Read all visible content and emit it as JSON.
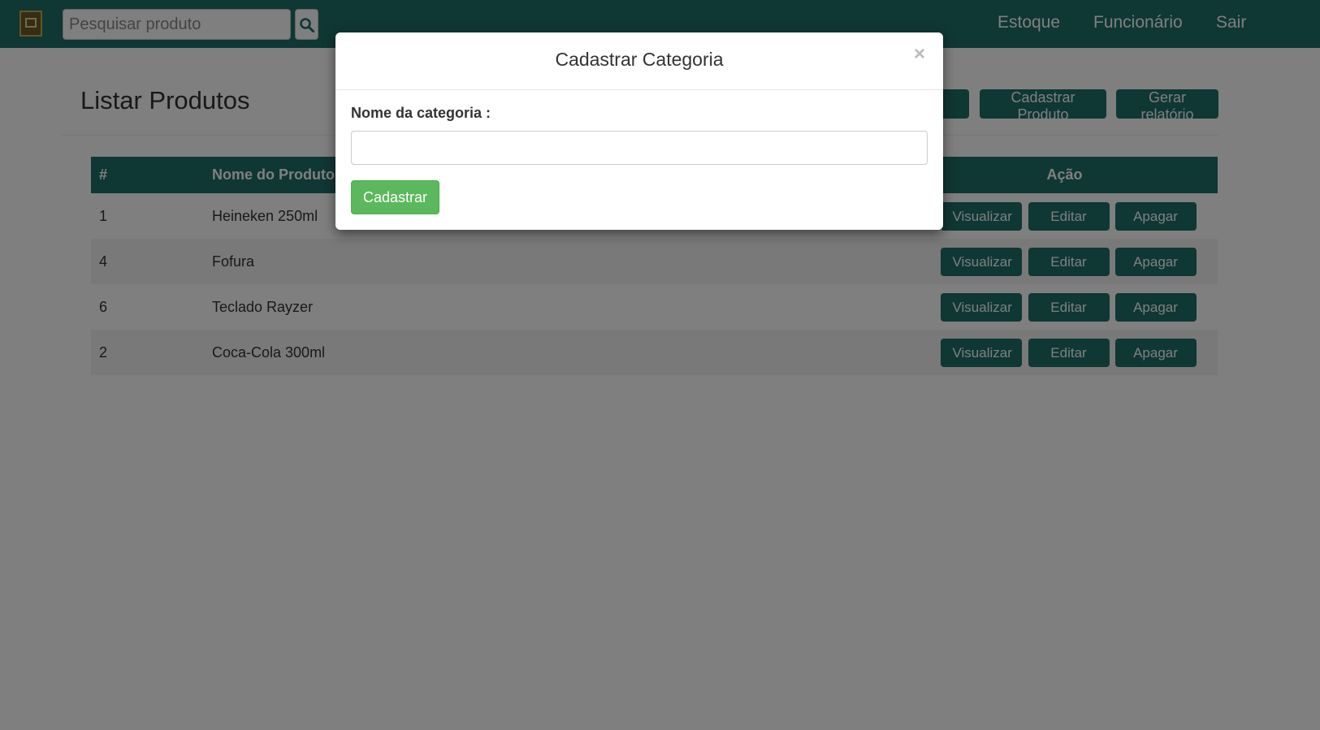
{
  "navbar": {
    "search_placeholder": "Pesquisar produto",
    "links": [
      {
        "label": "Estoque"
      },
      {
        "label": "Funcionário"
      },
      {
        "label": "Sair"
      }
    ]
  },
  "page": {
    "title": "Listar Produtos",
    "buttons": {
      "cadastrar_categoria": "Cadastrar Categoria",
      "cadastrar_produto": "Cadastrar Produto",
      "gerar_relatorio": "Gerar relatório"
    }
  },
  "table": {
    "headers": {
      "id": "#",
      "name": "Nome do Produto",
      "actions": "Ação"
    },
    "rows": [
      {
        "id": "1",
        "name": "Heineken 250ml"
      },
      {
        "id": "4",
        "name": "Fofura"
      },
      {
        "id": "6",
        "name": "Teclado Rayzer"
      },
      {
        "id": "2",
        "name": "Coca-Cola 300ml"
      }
    ],
    "action_labels": {
      "view": "Visualizar",
      "edit": "Editar",
      "delete": "Apagar"
    }
  },
  "modal": {
    "title": "Cadastrar Categoria",
    "close_symbol": "×",
    "field_label": "Nome da categoria :",
    "field_value": "",
    "submit_label": "Cadastrar"
  },
  "colors": {
    "primary": "#1e6f69",
    "success": "#5cb85c",
    "backdrop": "rgba(0,0,0,0.5)"
  },
  "icons": {
    "logo": "logo-icon",
    "search": "search-icon",
    "close": "close-icon"
  }
}
